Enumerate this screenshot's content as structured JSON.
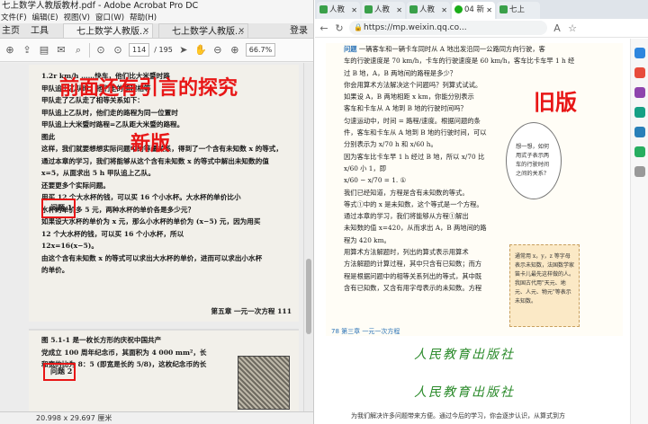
{
  "acrobat": {
    "title": "七上数学人教版教材.pdf - Adobe Acrobat Pro DC",
    "menu": [
      "文件(F)",
      "编辑(E)",
      "视图(V)",
      "窗口(W)",
      "帮助(H)"
    ],
    "tab_home": "主页",
    "tab_tools": "工具",
    "doc_tabs": [
      "七上数学人教版...",
      "七上数学人教版..."
    ],
    "login": "登录",
    "page_current": "114",
    "page_total": "/ 195",
    "zoom": "66.7%",
    "status_size": "20.998 x 29.697 厘米",
    "scan_lines": [
      "1.2r km/h          ……快车，他们比大米暨时路",
      "甲队追上乙队时，他们走的路程相等",
      "甲队走了乙队走了相等关系如下：",
      "甲队追上乙队时，他们走的路程为同一位置时",
      "甲队追上大米暨时路程=乙队距大米暨的路程。",
      "",
      "图此",
      "",
      "这样，我们就要想想实际问题中的等量关系，得到了一个含有未知数 x 的等式，",
      "通过本章的学习，我们将能够从这个含有未知数 x 的等式中解出未知数的值",
      "x=5，从面求出 5 h 甲队追上乙队。",
      "    还要更多个实际问题。",
      "",
      "      用买 12 个大水杯的钱，可以买 16 个小水杯。大水杯的单价比小",
      "水杯的单价多 5 元，两种水杯的单价各是多少元？",
      "    如果设大水杯的单价为 x 元，那么小水杯的单价为 (x−5) 元，因为用买",
      "12 个大水杯的钱，可以买 16 个小水杯，所以",
      "                          12x=16(x−5)。",
      "    由这个含有未知数 x 的等式可以求出大水杯的单价，进而可以求出小水杯",
      "的单价。"
    ],
    "scan_footer": "第五章   一元一次方程   111",
    "scan2_lines": [
      "",
      "      图 5.1-1 是一枚长方形的庆祝中国共产",
      "党成立 100 周年纪念币，其面积为 4 000 mm²，长",
      "和宽的比为 8：5 (即宽是长的 5/8)，这枚纪念币的长"
    ],
    "overlay_intro": "前面还有引言的探究",
    "overlay_new": "新版",
    "label_q1": "问题 1",
    "label_q2": "问题 2"
  },
  "browser": {
    "tabs": [
      "人教",
      "人教",
      "人教",
      "04 新",
      "七上"
    ],
    "url": "https://mp.weixin.qq.co...",
    "overlay_old": "旧版",
    "book_lines": [
      "问题   一辆客车和一辆卡车同时从 A 地出发沿同一公路同方向行驶，客",
      "车的行驶速度是 70 km/h，卡车的行驶速度是 60 km/h，客车比卡车早 1 h 经",
      "过 B 地，A，B 两地间的路程是多少？",
      "",
      "    你会用算术方法解决这个问题吗？列算式试试。",
      "    如果设 A，B 两地相距 x km，你能分别表示",
      "客车和卡车从 A 地到 B 地的行驶时间吗？",
      "    匀速运动中，时间 = 路程/速度。根据问题的条",
      "件，客车和卡车从 A 地到 B 地的行驶时间，可以",
      "分别表示为 x/70 h 和 x/60 h。",
      "    因为客车比卡车早 1 h 经过 B 地，所以 x/70 比",
      "x/60 小 1，即",
      "                 x/60 − x/70 = 1.                         ①",
      "    我们已经知道，方程是含有未知数的等式。",
      "等式①中的 x 是未知数，这个等式是一个方程。",
      "    通过本章的学习，我们将能够从方程①解出",
      "未知数的值 x=420，从而求出 A，B 两地间的路",
      "程为 420 km。",
      "    用算术方法解题时，列出的算式表示用算术",
      "方法解题的计算过程，其中只含有已知数；而方",
      "程是根据问题中的相等关系列出的等式，其中既",
      "含有已知数，又含有用字母表示的未知数。方程"
    ],
    "bubble_text": "想一想，如何用式子表示两车的行驶时间之间的关系？",
    "note_text": "通常用 x，y，z 等字母表示未知数，法国数学家笛卡儿最先这样做的人。我国古代用\"天元、地元、人元、物元\"等表示未知数。",
    "book_footer": "78   第三章   一元一次方程",
    "brand": "人民教育出版社",
    "bottom_line": "为我们解决许多问题带来方便。通过今后的学习，你会逐步认识，从算式到方"
  }
}
